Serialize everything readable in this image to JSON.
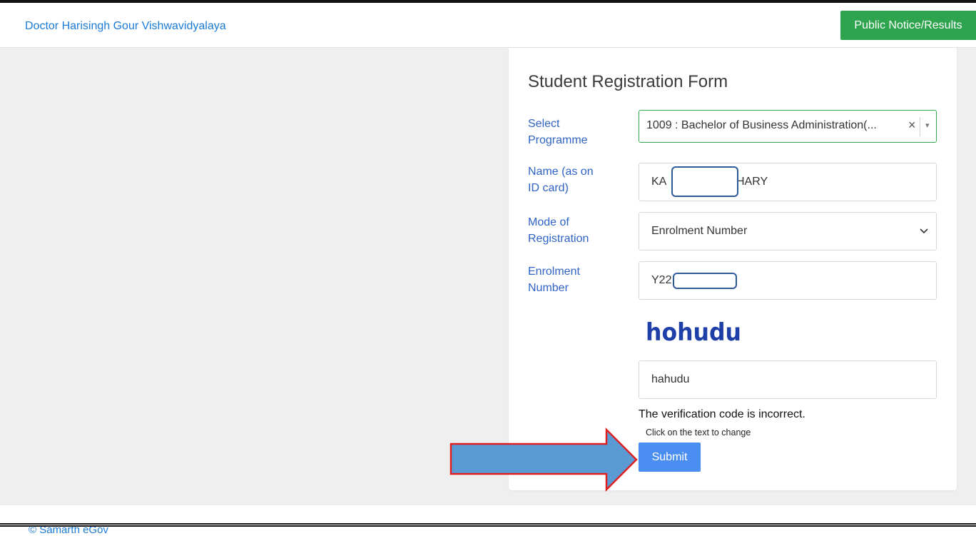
{
  "header": {
    "brand": "Doctor Harisingh Gour Vishwavidyalaya",
    "notice_button": "Public Notice/Results"
  },
  "form": {
    "title": "Student Registration Form",
    "programme": {
      "label_line1": "Select",
      "label_line2": "Programme",
      "value": "1009 : Bachelor of Business Administration(...",
      "clear_glyph": "×",
      "caret_glyph": "▾"
    },
    "name": {
      "label_line1": "Name (as on",
      "label_line2": "ID card)",
      "value_prefix": "KA",
      "value_suffix": "HARY"
    },
    "mode": {
      "label_line1": "Mode of",
      "label_line2": "Registration",
      "value": "Enrolment Number"
    },
    "enrolment": {
      "label_line1": "Enrolment",
      "label_line2": "Number",
      "value_prefix": "Y22"
    },
    "captcha": {
      "image_text": "hohudu",
      "input_value": "hahudu",
      "error": "The verification code is incorrect.",
      "hint": "Click on the text to change"
    },
    "submit_label": "Submit"
  },
  "footer": {
    "copyright": "© Samarth eGov"
  },
  "colors": {
    "brand_link": "#1b7bd6",
    "label": "#2f63c6",
    "success_button": "#2ea44f",
    "primary_button": "#4b8ef1",
    "captcha_text": "#1f3fa8",
    "annotation_arrow_fill": "#5b9bd5",
    "annotation_arrow_stroke": "#e02020"
  }
}
